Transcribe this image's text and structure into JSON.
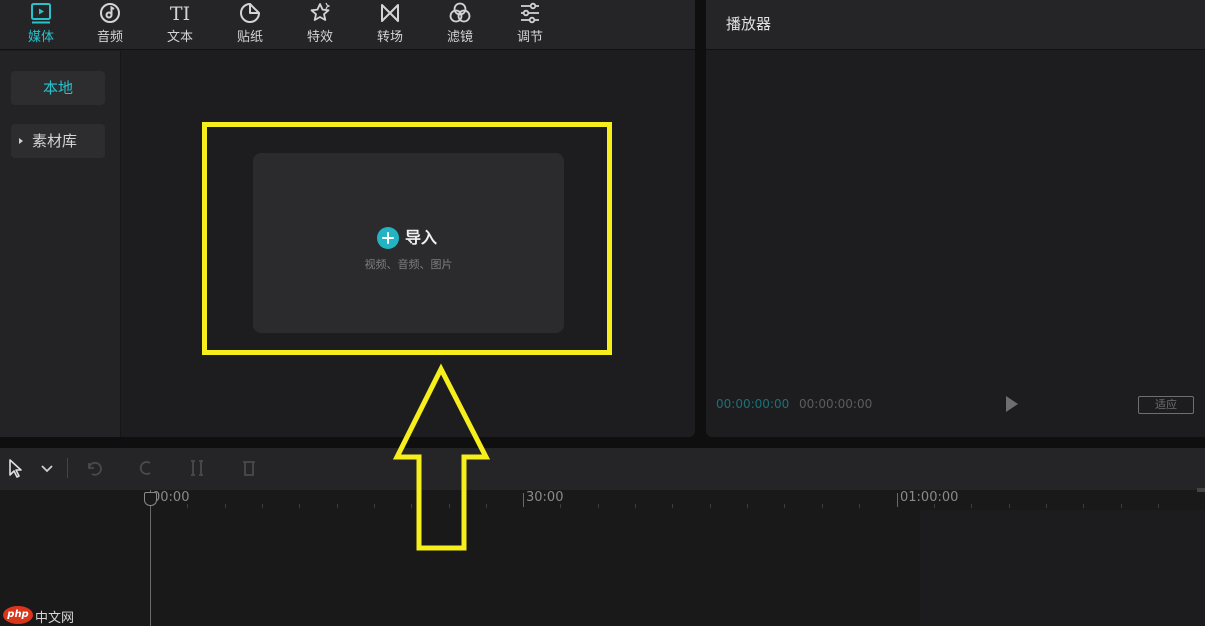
{
  "toolbar": {
    "tabs": [
      {
        "label": "媒体",
        "icon": "media-icon",
        "active": true
      },
      {
        "label": "音频",
        "icon": "audio-icon",
        "active": false
      },
      {
        "label": "文本",
        "icon": "text-icon",
        "active": false
      },
      {
        "label": "贴纸",
        "icon": "sticker-icon",
        "active": false
      },
      {
        "label": "特效",
        "icon": "effects-icon",
        "active": false
      },
      {
        "label": "转场",
        "icon": "transition-icon",
        "active": false
      },
      {
        "label": "滤镜",
        "icon": "filter-icon",
        "active": false
      },
      {
        "label": "调节",
        "icon": "adjust-icon",
        "active": false
      }
    ],
    "text_icon_glyph": "TI"
  },
  "sidebar": {
    "local": "本地",
    "library": "素材库"
  },
  "import": {
    "label": "导入",
    "subtitle": "视频、音频、图片"
  },
  "player": {
    "title": "播放器",
    "current_time": "00:00:00:00",
    "total_time": "00:00:00:00",
    "ratio_label": "适应"
  },
  "timeline": {
    "ruler_labels": [
      "00:00",
      "30:00",
      "01:00:00"
    ]
  },
  "watermark": {
    "logo": "php",
    "text": "中文网"
  },
  "colors": {
    "accent": "#27c3cc",
    "annotation": "#f6ef1b",
    "panel": "#1d1d1f",
    "background": "#0f0f10"
  }
}
